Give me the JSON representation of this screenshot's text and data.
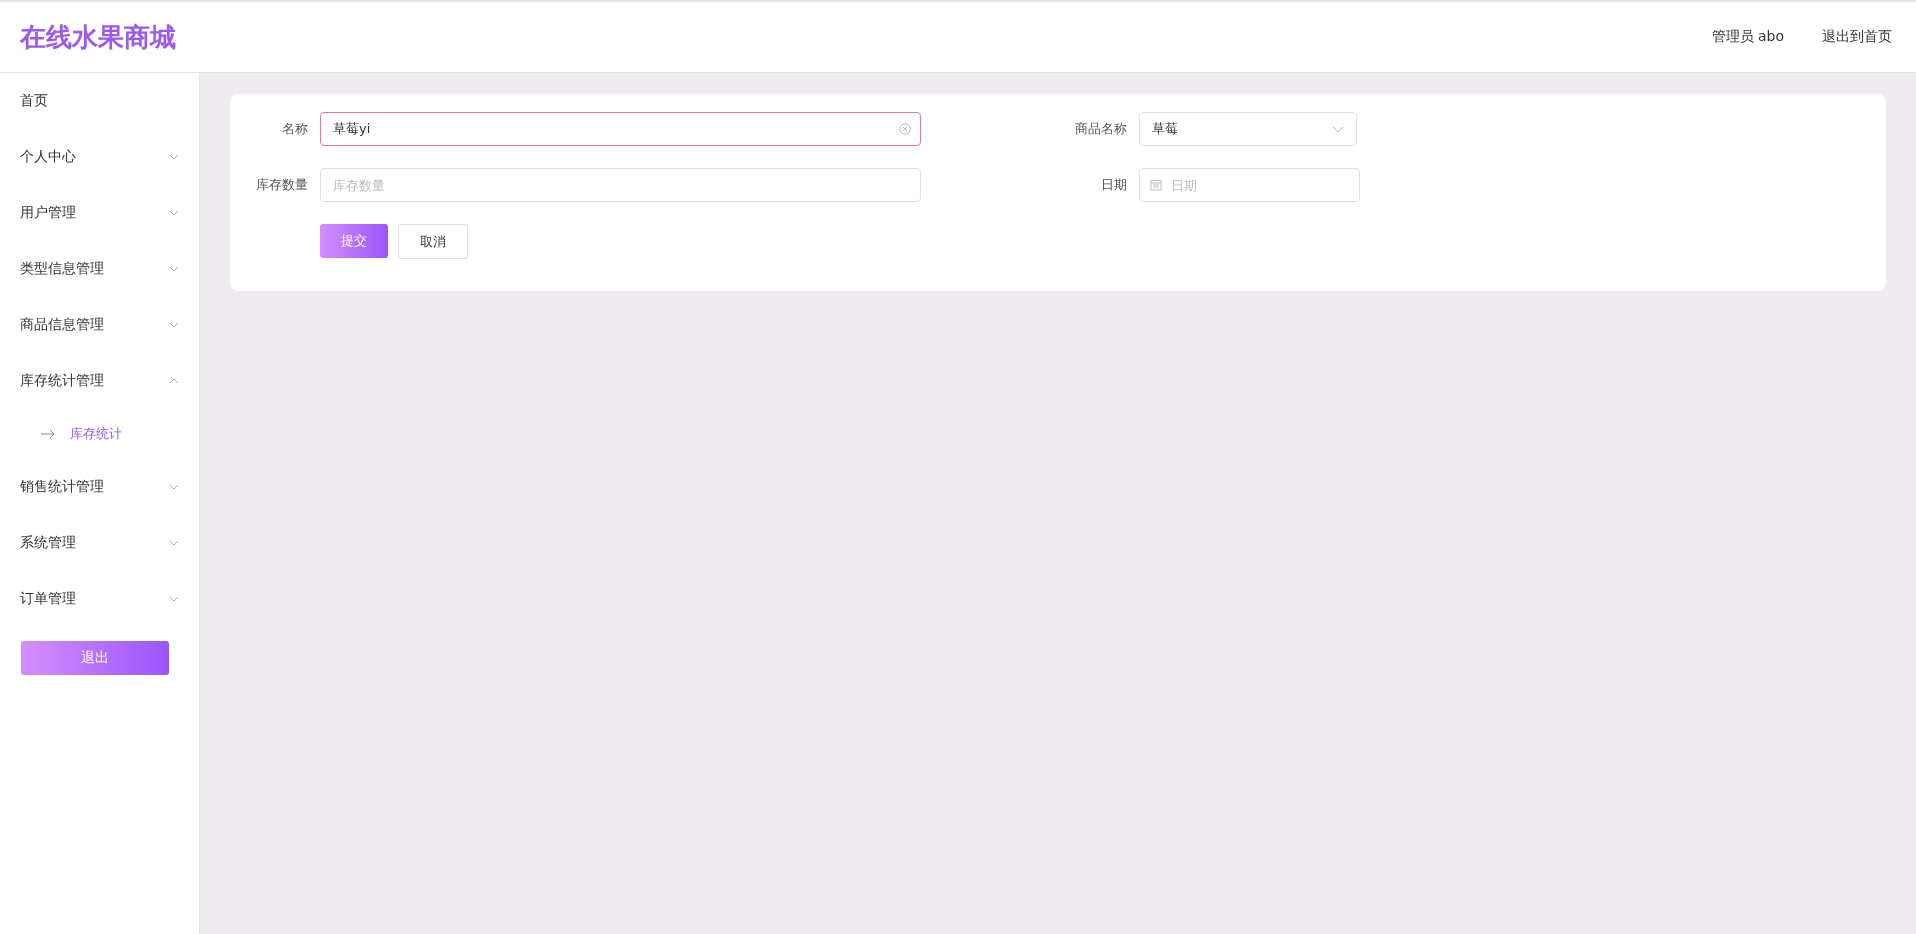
{
  "header": {
    "logo": "在线水果商城",
    "user": "管理员 abo",
    "home_link": "退出到首页"
  },
  "sidebar": {
    "home": {
      "label": "首页"
    },
    "menus": [
      {
        "label": "个人中心",
        "expanded": false
      },
      {
        "label": "用户管理",
        "expanded": false
      },
      {
        "label": "类型信息管理",
        "expanded": false
      },
      {
        "label": "商品信息管理",
        "expanded": false
      },
      {
        "label": "库存统计管理",
        "expanded": true,
        "children": [
          {
            "label": "库存统计",
            "selected": true
          }
        ]
      },
      {
        "label": "销售统计管理",
        "expanded": false
      },
      {
        "label": "系统管理",
        "expanded": false
      },
      {
        "label": "订单管理",
        "expanded": false
      }
    ],
    "logout": "退出"
  },
  "form": {
    "columns": [
      [
        {
          "kind": "text",
          "label": "名称",
          "value": "草莓yi",
          "focused": true,
          "clearable": true
        },
        {
          "kind": "text",
          "label": "库存数量",
          "placeholder": "库存数量",
          "focused": false
        }
      ],
      [
        {
          "kind": "select",
          "label": "商品名称",
          "value": "草莓",
          "focused": false
        },
        {
          "kind": "date",
          "label": "日期",
          "placeholder": "日期",
          "focused": false
        }
      ]
    ],
    "submit": "提交",
    "cancel": "取消"
  }
}
